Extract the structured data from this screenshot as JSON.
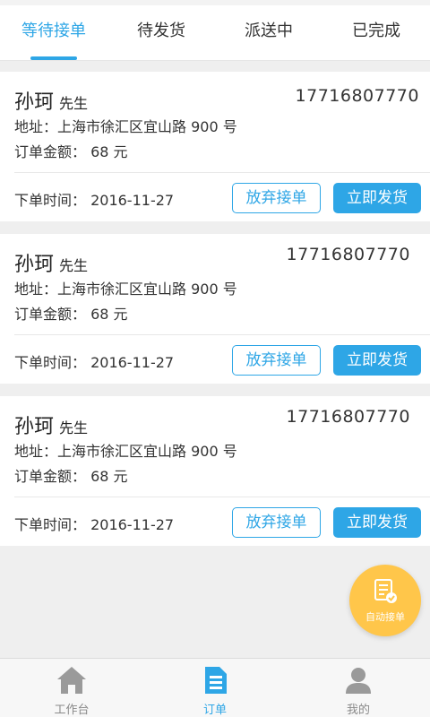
{
  "tabs": [
    {
      "label": "等待接单",
      "active": true
    },
    {
      "label": "待发货",
      "active": false
    },
    {
      "label": "派送中",
      "active": false
    },
    {
      "label": "已完成",
      "active": false
    }
  ],
  "orders": [
    {
      "name": "孙珂",
      "title": "先生",
      "phone": "17716807770",
      "address": "地址：上海市徐汇区宜山路 900 号",
      "amount": "订单金额： 68 元",
      "time": "下单时间： 2016-11-27",
      "abandon_label": "放弃接单",
      "ship_label": "立即发货"
    },
    {
      "name": "孙珂",
      "title": "先生",
      "phone": "17716807770",
      "address": "地址：上海市徐汇区宜山路 900 号",
      "amount": "订单金额： 68 元",
      "time": "下单时间： 2016-11-27",
      "abandon_label": "放弃接单",
      "ship_label": "立即发货"
    },
    {
      "name": "孙珂",
      "title": "先生",
      "phone": "17716807770",
      "address": "地址：上海市徐汇区宜山路 900 号",
      "amount": "订单金额： 68 元",
      "time": "下单时间： 2016-11-27",
      "abandon_label": "放弃接单",
      "ship_label": "立即发货"
    }
  ],
  "fab": {
    "label": "自动接单",
    "icon": "auto-order-icon"
  },
  "bottom_nav": [
    {
      "label": "工作台",
      "icon": "home-icon",
      "active": false
    },
    {
      "label": "订单",
      "icon": "order-doc-icon",
      "active": true
    },
    {
      "label": "我的",
      "icon": "user-icon",
      "active": false
    }
  ],
  "colors": {
    "accent": "#2ea6e6",
    "fab": "#ffc64a",
    "background": "#efefef"
  }
}
